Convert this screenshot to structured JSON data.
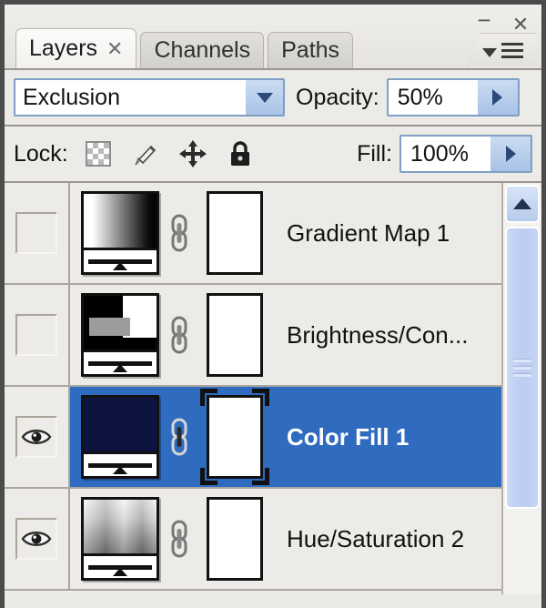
{
  "window": {
    "minimize_label": "−",
    "close_label": "✕"
  },
  "tabs": [
    {
      "label": "Layers",
      "active": true,
      "close_label": "✕"
    },
    {
      "label": "Channels",
      "active": false
    },
    {
      "label": "Paths",
      "active": false
    }
  ],
  "panel_menu": {
    "icon": "panel-menu-icon"
  },
  "blend": {
    "mode": "Exclusion",
    "opacity_label": "Opacity:",
    "opacity_value": "50%"
  },
  "lock": {
    "label": "Lock:",
    "icons": [
      "lock-transparency-icon",
      "lock-image-icon",
      "lock-position-icon",
      "lock-all-icon"
    ],
    "fill_label": "Fill:",
    "fill_value": "100%"
  },
  "layers": [
    {
      "name": "Gradient Map 1",
      "visible": false,
      "selected": false,
      "linked": true,
      "mask_selected": false,
      "thumb": "gradient-horizontal"
    },
    {
      "name": "Brightness/Con...",
      "visible": false,
      "selected": false,
      "linked": true,
      "mask_selected": false,
      "thumb": "brightness-contrast"
    },
    {
      "name": "Color Fill 1",
      "visible": true,
      "selected": true,
      "linked": true,
      "mask_selected": true,
      "thumb": "solid-navy"
    },
    {
      "name": "Hue/Saturation 2",
      "visible": true,
      "selected": false,
      "linked": true,
      "mask_selected": false,
      "thumb": "gradient-vertical"
    }
  ],
  "scrollbar": {
    "up_arrow": "chevron-up-icon",
    "position": "top"
  },
  "colors": {
    "selection_blue": "#2f6cc0",
    "panel_bg": "#ecebe7",
    "field_border": "#7f9fc4",
    "navy_fill": "#0d1440",
    "scroll_thumb": "#c2d0f3"
  }
}
